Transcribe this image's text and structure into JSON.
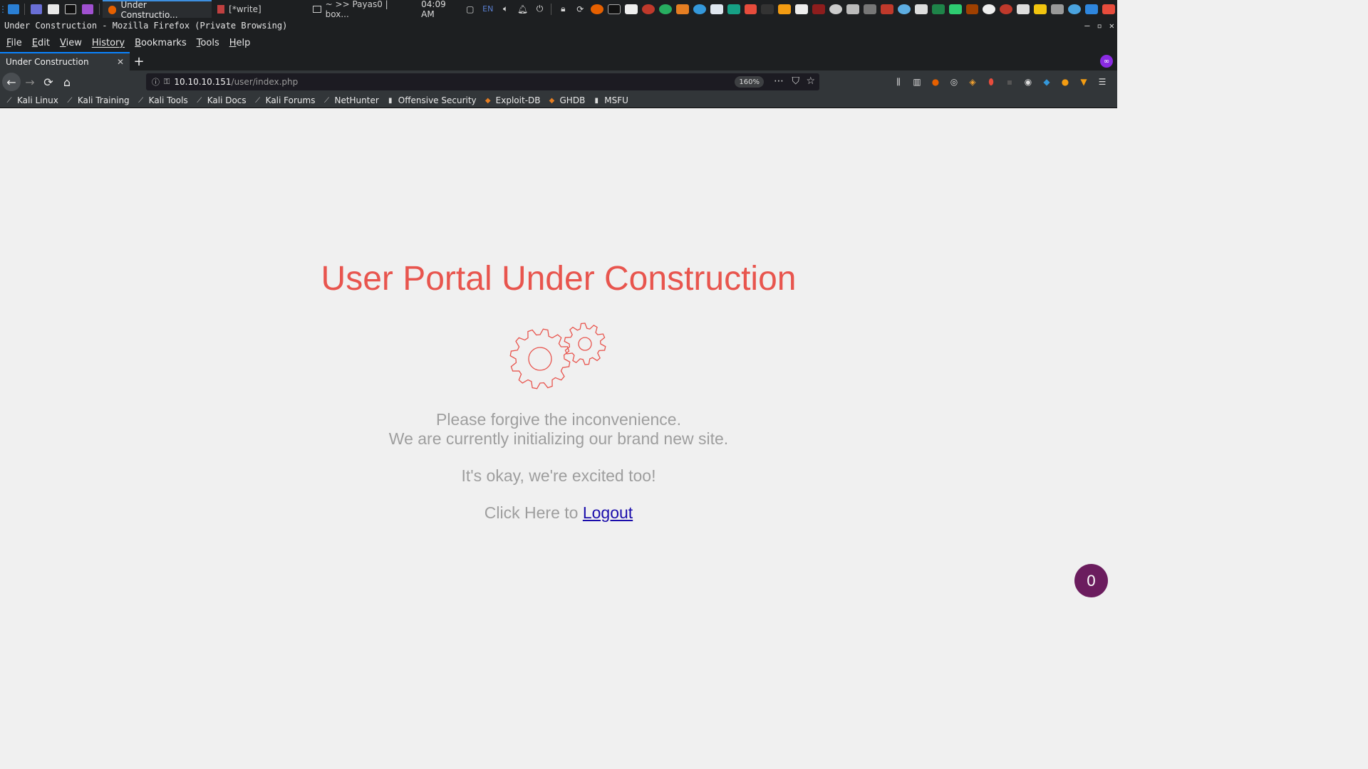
{
  "system_panel": {
    "active_task": "Under Constructio...",
    "task_write": "[*write]",
    "terminal_task": "~ >> Payas0 | box...",
    "clock": "04:09 AM",
    "lang": "EN"
  },
  "window": {
    "title": "Under Construction - Mozilla Firefox (Private Browsing)"
  },
  "menubar": {
    "items": [
      {
        "key": "F",
        "rest": "ile"
      },
      {
        "key": "E",
        "rest": "dit"
      },
      {
        "key": "V",
        "rest": "iew"
      },
      {
        "key": "H",
        "rest": "istory",
        "key_after": "s"
      },
      {
        "key": "B",
        "rest": "ookmarks"
      },
      {
        "key": "T",
        "rest": "ools"
      },
      {
        "key": "H",
        "rest": "elp"
      }
    ],
    "labels": [
      "File",
      "Edit",
      "View",
      "History",
      "Bookmarks",
      "Tools",
      "Help"
    ]
  },
  "tab": {
    "title": "Under Construction"
  },
  "urlbar": {
    "host": "10.10.10.151",
    "path": "/user/index.php",
    "zoom": "160%"
  },
  "bookmarks": [
    "Kali Linux",
    "Kali Training",
    "Kali Tools",
    "Kali Docs",
    "Kali Forums",
    "NetHunter",
    "Offensive Security",
    "Exploit-DB",
    "GHDB",
    "MSFU"
  ],
  "page": {
    "heading": "User Portal Under Construction",
    "line1": "Please forgive the inconvenience.",
    "line2": "We are currently initializing our brand new site.",
    "line3": "It's okay, we're excited too!",
    "logout_prefix": "Click Here to ",
    "logout_link": "Logout",
    "badge_count": "0"
  },
  "colors": {
    "heading": "#e8554e",
    "text": "#9e9e9e",
    "link": "#1a0dab",
    "fab": "#6b1d5e",
    "accent_tab": "#0a84ff"
  }
}
